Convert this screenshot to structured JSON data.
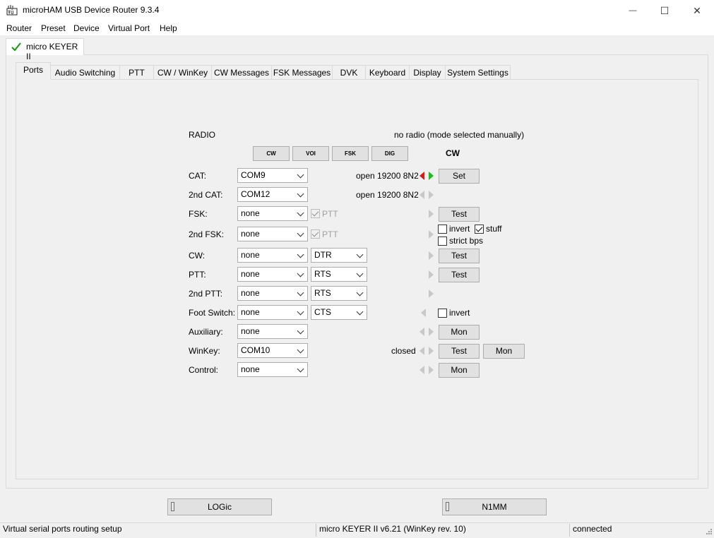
{
  "window": {
    "title": "microHAM USB Device Router 9.3.4",
    "minimize_glyph": "—",
    "maximize_glyph": "☐",
    "close_glyph": "✕"
  },
  "menu": [
    "Router",
    "Preset",
    "Device",
    "Virtual Port",
    "Help"
  ],
  "device_tab": {
    "label": "micro KEYER II",
    "status_icon": "checkmark-icon",
    "status_color": "#1a9e1a"
  },
  "tabs": [
    "Ports",
    "Audio Switching",
    "PTT",
    "CW / WinKey",
    "CW Messages",
    "FSK Messages",
    "DVK",
    "Keyboard",
    "Display",
    "System Settings"
  ],
  "radio": {
    "label": "RADIO",
    "status": "no radio (mode selected manually)",
    "mode_buttons": [
      "CW",
      "VOI",
      "FSK",
      "DIG"
    ],
    "current_mode": "CW"
  },
  "ports": {
    "cat": {
      "label": "CAT:",
      "value": "COM9",
      "status": "open 19200 8N2",
      "button": "Set"
    },
    "cat2": {
      "label": "2nd CAT:",
      "value": "COM12",
      "status": "open 19200 8N2"
    },
    "fsk": {
      "label": "FSK:",
      "value": "none",
      "ptt_label": "PTT",
      "button": "Test"
    },
    "fsk2": {
      "label": "2nd FSK:",
      "value": "none",
      "ptt_label": "PTT",
      "invert_label": "invert",
      "stuff_label": "stuff",
      "strict_label": "strict bps"
    },
    "cw": {
      "label": "CW:",
      "value": "none",
      "line": "DTR",
      "button": "Test"
    },
    "ptt": {
      "label": "PTT:",
      "value": "none",
      "line": "RTS",
      "button": "Test"
    },
    "ptt2": {
      "label": "2nd PTT:",
      "value": "none",
      "line": "RTS"
    },
    "foot": {
      "label": "Foot Switch:",
      "value": "none",
      "line": "CTS",
      "invert_label": "invert"
    },
    "aux": {
      "label": "Auxiliary:",
      "value": "none",
      "button": "Mon"
    },
    "winkey": {
      "label": "WinKey:",
      "value": "COM10",
      "status": "closed",
      "test_button": "Test",
      "mon_button": "Mon"
    },
    "control": {
      "label": "Control:",
      "value": "none",
      "button": "Mon"
    }
  },
  "bottom_buttons": [
    "LOGic",
    "N1MM"
  ],
  "statusbar": {
    "left": "Virtual serial ports routing setup",
    "middle": "micro KEYER II v6.21 (WinKey rev. 10)",
    "right": "connected"
  }
}
